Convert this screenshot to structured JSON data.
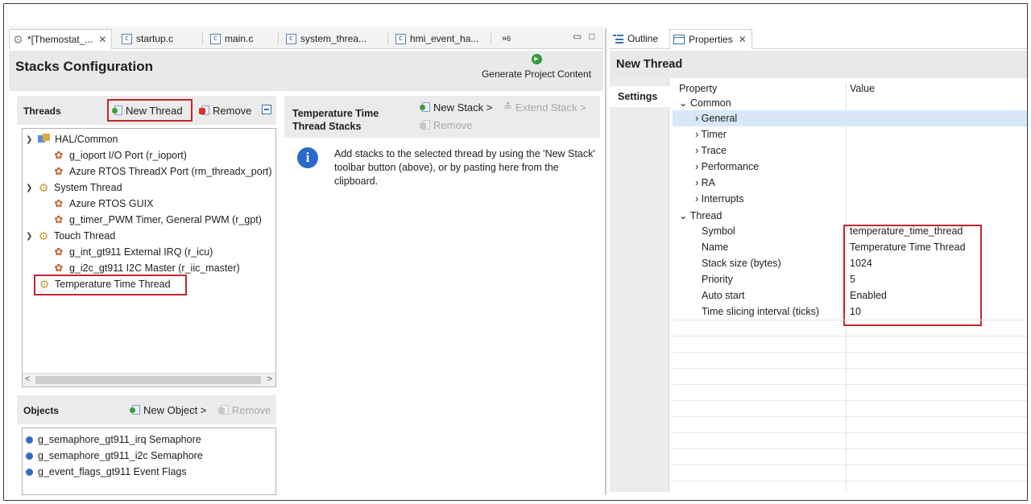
{
  "editor": {
    "tabs": [
      {
        "label": "*[Themostat_...",
        "icon": "settings-icon",
        "active": true
      },
      {
        "label": "startup.c",
        "icon": "c-file-icon"
      },
      {
        "label": "main.c",
        "icon": "c-file-icon"
      },
      {
        "label": "system_threa...",
        "icon": "c-file-icon"
      },
      {
        "label": "hmi_event_ha...",
        "icon": "c-file-icon"
      }
    ],
    "overflow_label": "»",
    "overflow_count": "6",
    "minimize_glyph": "▭",
    "maximize_glyph": "□"
  },
  "stacks_config": {
    "title": "Stacks Configuration",
    "generate_label": "Generate Project Content"
  },
  "threads": {
    "title": "Threads",
    "new_thread_label": "New Thread",
    "remove_label": "Remove",
    "tree": [
      {
        "label": "HAL/Common",
        "level": 0,
        "expanded": true,
        "icon": "hal-icon"
      },
      {
        "label": "g_ioport I/O Port (r_ioport)",
        "level": 1,
        "icon": "module-icon"
      },
      {
        "label": "Azure RTOS ThreadX Port (rm_threadx_port)",
        "level": 1,
        "icon": "module-icon"
      },
      {
        "label": "System Thread",
        "level": 0,
        "expanded": true,
        "icon": "gear-icon"
      },
      {
        "label": "Azure RTOS GUIX",
        "level": 1,
        "icon": "module-icon"
      },
      {
        "label": "g_timer_PWM Timer, General PWM (r_gpt)",
        "level": 1,
        "icon": "module-icon"
      },
      {
        "label": "Touch Thread",
        "level": 0,
        "expanded": true,
        "icon": "gear-icon"
      },
      {
        "label": "g_int_gt911 External IRQ (r_icu)",
        "level": 1,
        "icon": "module-icon"
      },
      {
        "label": "g_i2c_gt911 I2C Master (r_iic_master)",
        "level": 1,
        "icon": "module-icon"
      },
      {
        "label": "Temperature Time Thread",
        "level": 0,
        "icon": "gear-icon"
      }
    ]
  },
  "objects": {
    "title": "Objects",
    "new_object_label": "New Object >",
    "remove_label": "Remove",
    "items": [
      "g_semaphore_gt911_irq Semaphore",
      "g_semaphore_gt911_i2c Semaphore",
      "g_event_flags_gt911 Event Flags"
    ]
  },
  "stacks": {
    "title": "Temperature Time Thread Stacks",
    "new_stack_label": "New Stack >",
    "extend_stack_label": "Extend Stack >",
    "remove_label": "Remove",
    "info_text": "Add stacks to the selected thread by using the 'New Stack' toolbar button (above), or by pasting here from the clipboard."
  },
  "properties_view": {
    "tabs": [
      {
        "label": "Outline",
        "icon": "outline-icon"
      },
      {
        "label": "Properties",
        "icon": "properties-icon",
        "active": true
      }
    ],
    "title": "New Thread",
    "settings_tab": "Settings",
    "col_property": "Property",
    "col_value": "Value",
    "rows": [
      {
        "name": "Common",
        "value": "",
        "level": 0,
        "expander": "v"
      },
      {
        "name": "General",
        "value": "",
        "level": 1,
        "expander": ">",
        "selected": true
      },
      {
        "name": "Timer",
        "value": "",
        "level": 1,
        "expander": ">"
      },
      {
        "name": "Trace",
        "value": "",
        "level": 1,
        "expander": ">"
      },
      {
        "name": "Performance",
        "value": "",
        "level": 1,
        "expander": ">"
      },
      {
        "name": "RA",
        "value": "",
        "level": 1,
        "expander": ">"
      },
      {
        "name": "Interrupts",
        "value": "",
        "level": 1,
        "expander": ">"
      },
      {
        "name": "Thread",
        "value": "",
        "level": 0,
        "expander": "v"
      },
      {
        "name": "Symbol",
        "value": "temperature_time_thread",
        "level": 1
      },
      {
        "name": "Name",
        "value": "Temperature Time Thread",
        "level": 1
      },
      {
        "name": "Stack size (bytes)",
        "value": "1024",
        "level": 1
      },
      {
        "name": "Priority",
        "value": "5",
        "level": 1
      },
      {
        "name": "Auto start",
        "value": "Enabled",
        "level": 1
      },
      {
        "name": "Time slicing interval (ticks)",
        "value": "10",
        "level": 1
      }
    ]
  },
  "colors": {
    "highlight_box": "#c0282d",
    "selection": "#d9e8f8",
    "info_icon": "#2a6ac8",
    "generate_icon": "#2e9a38"
  }
}
